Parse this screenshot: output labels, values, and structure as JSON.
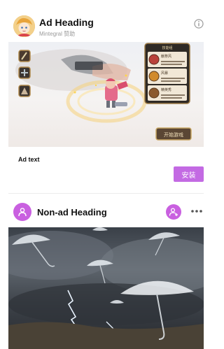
{
  "ad": {
    "heading": "Ad Heading",
    "sponsor": "Mintegral 赞助",
    "text": "Ad text",
    "install_label": "安装",
    "game_panel": {
      "title": "技能组",
      "rows": [
        "献祭风",
        "风暴",
        "精英秀"
      ],
      "start_label": "开始游戏"
    }
  },
  "post": {
    "heading": "Non-ad Heading"
  },
  "colors": {
    "accent": "#c960e0",
    "install": "#c36ae3"
  },
  "icons": {
    "info": "info-icon",
    "avatar": "user-icon",
    "follow": "add-user-icon",
    "more": "more-icon"
  }
}
